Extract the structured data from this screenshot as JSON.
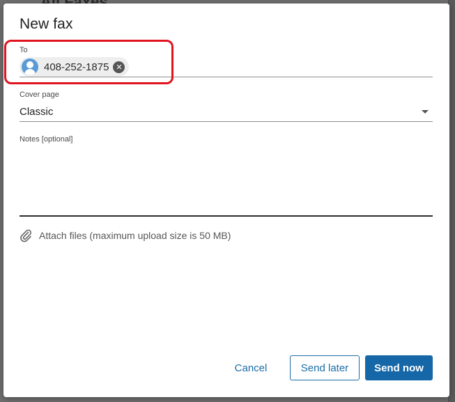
{
  "background": {
    "title_fragment": "All Faxes"
  },
  "dialog": {
    "title": "New fax",
    "to": {
      "label": "To",
      "recipients": [
        {
          "number": "408-252-1875",
          "remove_icon": "close-icon"
        }
      ]
    },
    "cover_page": {
      "label": "Cover page",
      "value": "Classic",
      "icon": "chevron-down-icon"
    },
    "notes": {
      "label": "Notes [optional]",
      "value": ""
    },
    "attach": {
      "label": "Attach files (maximum upload size is 50 MB)",
      "icon": "paperclip-icon"
    },
    "buttons": {
      "cancel": "Cancel",
      "send_later": "Send later",
      "send_now": "Send now"
    }
  },
  "colors": {
    "accent": "#1567a8",
    "highlight": "#e0141e",
    "avatar": "#5b9bd5"
  }
}
